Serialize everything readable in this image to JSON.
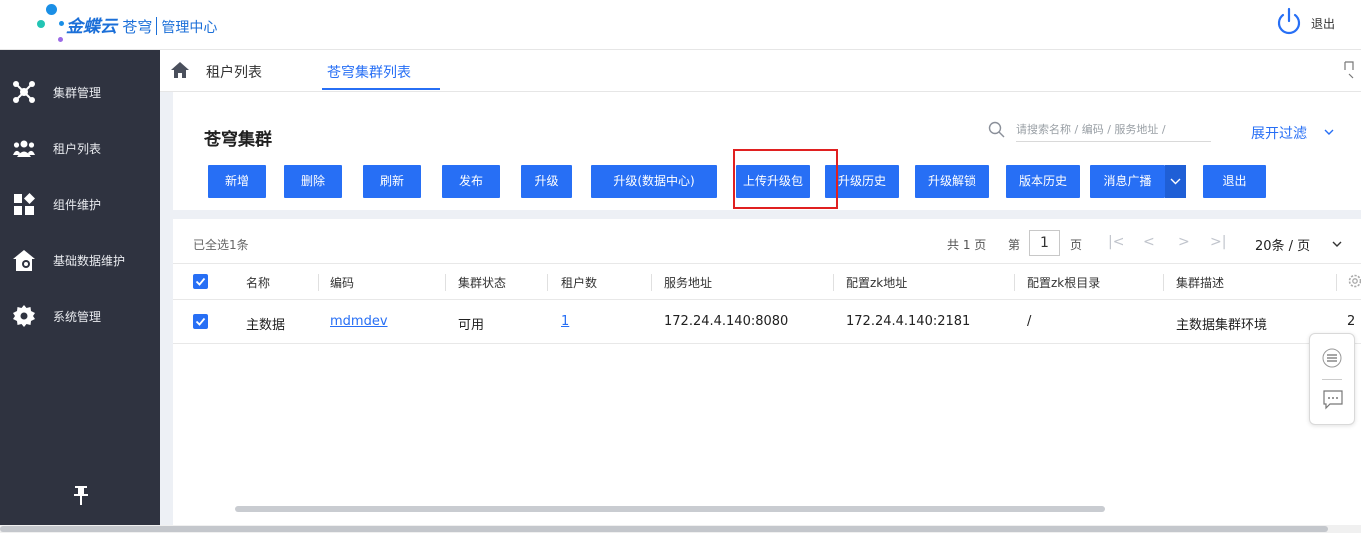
{
  "header": {
    "brand": "金蝶云",
    "brand_sub": "苍穹",
    "center": "管理中心",
    "logout": "退出",
    "colors": {
      "brand": "#1b6fd8",
      "dot_blue": "#1a8fe6",
      "dot_green": "#23c4b4",
      "dot_purple": "#9b6ae6"
    }
  },
  "sidebar": {
    "items": [
      {
        "label": "集群管理",
        "icon": "cluster-icon"
      },
      {
        "label": "租户列表",
        "icon": "users-icon"
      },
      {
        "label": "组件维护",
        "icon": "component-icon"
      },
      {
        "label": "基础数据维护",
        "icon": "house-icon"
      },
      {
        "label": "系统管理",
        "icon": "gear-icon"
      }
    ],
    "pin_icon": "pin-icon"
  },
  "tabs": [
    {
      "label": "租户列表",
      "active": false
    },
    {
      "label": "苍穹集群列表",
      "active": true
    }
  ],
  "page": {
    "title": "苍穹集群",
    "search_placeholder": "请搜索名称 / 编码 / 服务地址 /",
    "filter_label": "展开过滤"
  },
  "toolbar": {
    "buttons": [
      "新增",
      "删除",
      "刷新",
      "发布",
      "升级",
      "升级(数据中心)",
      "上传升级包",
      "升级历史",
      "升级解锁",
      "版本历史",
      "消息广播",
      "退出"
    ],
    "highlighted": "上传升级包"
  },
  "list": {
    "selected_text": "已全选1条",
    "pager": {
      "total": "共 1 页",
      "di": "第",
      "page": "1",
      "ye": "页",
      "page_size": "20条 / 页",
      "first": "|<",
      "prev": "<",
      "next": ">",
      "last": ">|"
    },
    "columns": [
      "名称",
      "编码",
      "集群状态",
      "租户数",
      "服务地址",
      "配置zk地址",
      "配置zk根目录",
      "集群描述"
    ],
    "rows": [
      {
        "name": "主数据",
        "code": "mdmdev",
        "status": "可用",
        "tenants": "1",
        "service": "172.24.4.140:8080",
        "zk": "172.24.4.140:2181",
        "zk_root": "/",
        "desc": "主数据集群环境",
        "extra": "2"
      }
    ]
  },
  "colors": {
    "primary": "#276ff5",
    "sidebar_bg": "#2f3340",
    "content_bg": "#edf0f5",
    "highlight": "#e02020"
  }
}
